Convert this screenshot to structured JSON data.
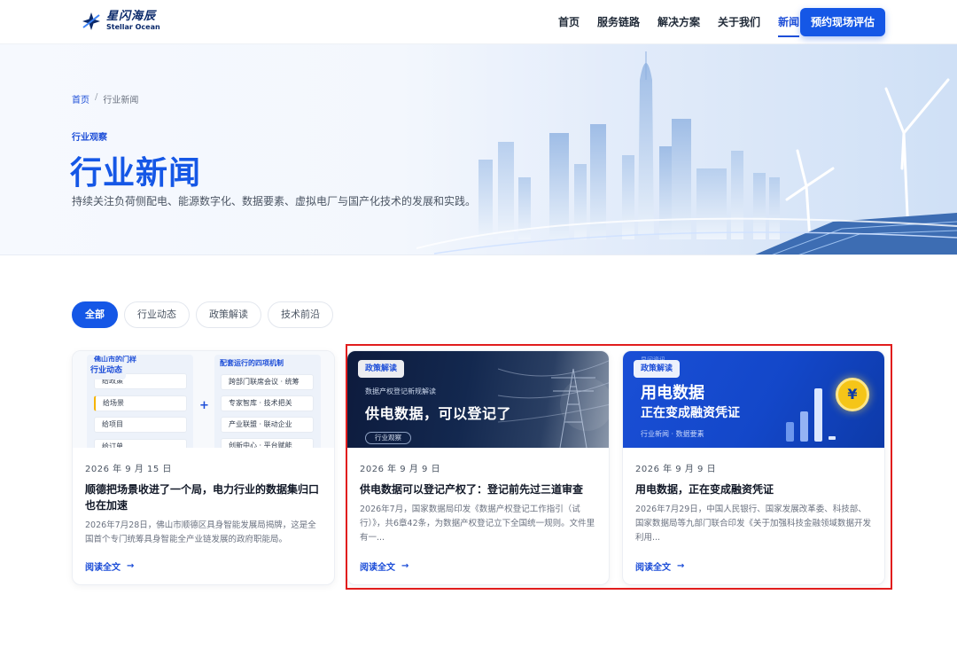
{
  "header": {
    "logo_cn": "星闪海辰",
    "logo_en": "Stellar Ocean",
    "nav": [
      {
        "label": "首页",
        "active": false
      },
      {
        "label": "服务链路",
        "active": false
      },
      {
        "label": "解决方案",
        "active": false
      },
      {
        "label": "关于我们",
        "active": false
      },
      {
        "label": "新闻",
        "active": true
      }
    ],
    "cta_label": "预约现场评估"
  },
  "hero": {
    "breadcrumb_home": "首页",
    "breadcrumb_sep": "/",
    "breadcrumb_current": "行业新闻",
    "eyebrow": "行业观察",
    "title": "行业新闻",
    "subtitle": "持续关注负荷侧配电、能源数字化、数据要素、虚拟电厂与国产化技术的发展和实践。"
  },
  "filters": [
    {
      "label": "全部",
      "active": true
    },
    {
      "label": "行业动态",
      "active": false
    },
    {
      "label": "政策解读",
      "active": false
    },
    {
      "label": "技术前沿",
      "active": false
    }
  ],
  "cards": [
    {
      "tag": "行业动态",
      "image": {
        "left_head": "佛山市的门样",
        "left_items": [
          "给政策",
          "给场景",
          "给项目",
          "给订单"
        ],
        "right_head": "配套运行的四项机制",
        "right_items": [
          "跨部门联席会议 · 统筹",
          "专家智库 · 技术把关",
          "产业联盟 · 联动企业",
          "创新中心 · 平台赋能"
        ],
        "plus": "+"
      },
      "date": "2026 年 9 月 15 日",
      "title": "顺德把场景收进了一个局，电力行业的数据集归口也在加速",
      "excerpt": "2026年7月28日，佛山市顺德区具身智能发展局揭牌，这是全国首个专门统筹具身智能全产业链发展的政府职能局。",
      "read": "阅读全文"
    },
    {
      "tag": "政策解读",
      "image": {
        "small": "数据产权登记新规解读",
        "big": "供电数据，可以登记了",
        "pill": "行业观察"
      },
      "date": "2026 年 9 月 9 日",
      "title": "供电数据可以登记产权了：登记前先过三道审查",
      "excerpt": "2026年7月，国家数据局印发《数据产权登记工作指引（试行）》，共6章42条，为数据产权登记立下全国统一规则。文件里有一...",
      "read": "阅读全文"
    },
    {
      "tag": "政策解读",
      "image": {
        "pre": "早间资讯",
        "big1": "用电数据",
        "big2": "正在变成融资凭证",
        "small": "行业新闻 · 数据要素",
        "coin": "¥"
      },
      "date": "2026 年 9 月 9 日",
      "title": "用电数据，正在变成融资凭证",
      "excerpt": "2026年7月29日，中国人民银行、国家发展改革委、科技部、国家数据局等九部门联合印发《关于加强科技金融领域数据开发利用...",
      "read": "阅读全文"
    }
  ],
  "colors": {
    "brand": "#1557e6",
    "highlight": "#e11d1d"
  }
}
